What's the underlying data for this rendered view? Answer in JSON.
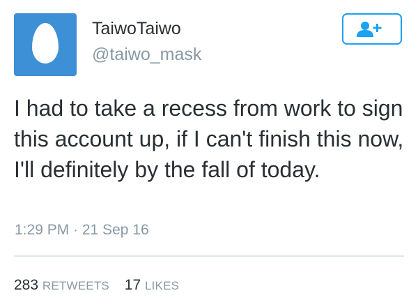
{
  "author": {
    "display_name": "TaiwoTaiwo",
    "username": "@taiwo_mask",
    "avatar_icon": "default-egg-avatar",
    "avatar_color": "#3d8fd6"
  },
  "follow_button": {
    "icon": "add-user-icon",
    "color": "#1da1f2"
  },
  "tweet": {
    "text": "I had to take a recess from work to sign this account up, if I can't finish this now, I'll definitely by the fall of today.",
    "timestamp": "1:29 PM · 21 Sep 16"
  },
  "stats": {
    "retweets_count": "283",
    "retweets_label": "RETWEETS",
    "likes_count": "17",
    "likes_label": "LIKES"
  },
  "colors": {
    "text": "#292f33",
    "secondary": "#8899a6",
    "accent": "#1da1f2",
    "divider": "#e1e8ed"
  }
}
